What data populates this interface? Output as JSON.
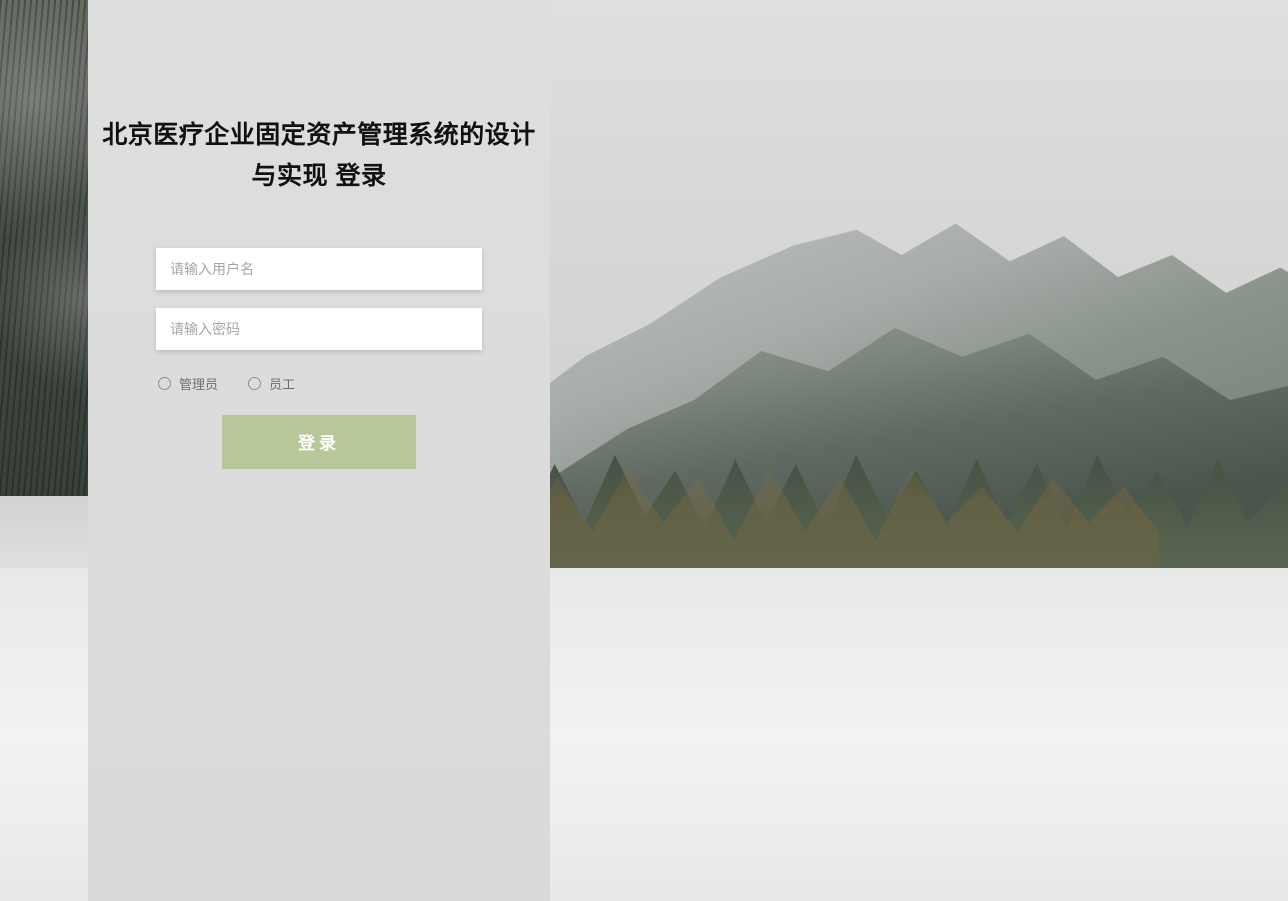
{
  "title": "北京医疗企业固定资产管理系统的设计与实现 登录",
  "form": {
    "username_placeholder": "请输入用户名",
    "password_placeholder": "请输入密码",
    "roles": {
      "admin": "管理员",
      "staff": "员工"
    },
    "login_label": "登录"
  },
  "colors": {
    "button_bg": "#b6c79a",
    "panel_bg": "#dcdcdc"
  }
}
